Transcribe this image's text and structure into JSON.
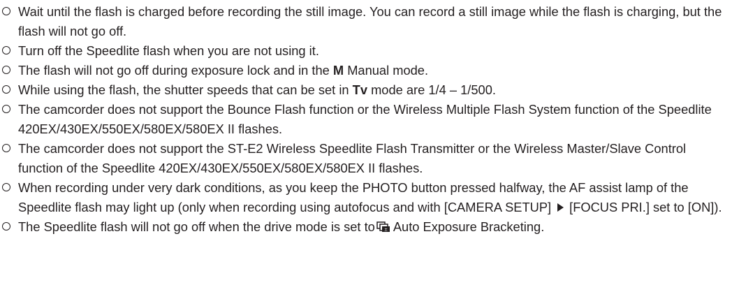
{
  "notes": [
    {
      "text": "Wait until the flash is charged before recording the still image. You can record a still image while the flash is charging, but the flash will not go off."
    },
    {
      "text": "Turn off the Speedlite flash when you are not using it."
    },
    {
      "pre": "The flash will not go off during exposure lock and in the ",
      "bold": "M",
      "post": " Manual mode."
    },
    {
      "pre": "While using the flash, the shutter speeds that can be set in ",
      "bold": "Tv",
      "post": " mode are 1/4 – 1/500."
    },
    {
      "text": "The camcorder does not support the Bounce Flash function or the Wireless Multiple Flash System function of the Speedlite 420EX/430EX/550EX/580EX/580EX II flashes."
    },
    {
      "text": "The camcorder does not support the ST-E2 Wireless Speedlite Flash Transmitter or the Wireless Master/Slave Control function of the Speedlite 420EX/430EX/550EX/580EX/580EX II flashes."
    },
    {
      "pre": "When recording under very dark conditions, as you keep the PHOTO button pressed halfway, the AF assist lamp of the Speedlite flash may light up (only when recording using autofocus and with [CAMERA SETUP]",
      "post": "[FOCUS PRI.] set to [ON])."
    },
    {
      "pre": "The Speedlite flash will not go off when the drive mode is set to",
      "post": "Auto Exposure Bracketing."
    }
  ],
  "icons": {
    "bullet": "circle-outline-icon",
    "menu_arrow": "right-arrow-icon",
    "drive_mode": "auto-exposure-bracketing-icon"
  }
}
